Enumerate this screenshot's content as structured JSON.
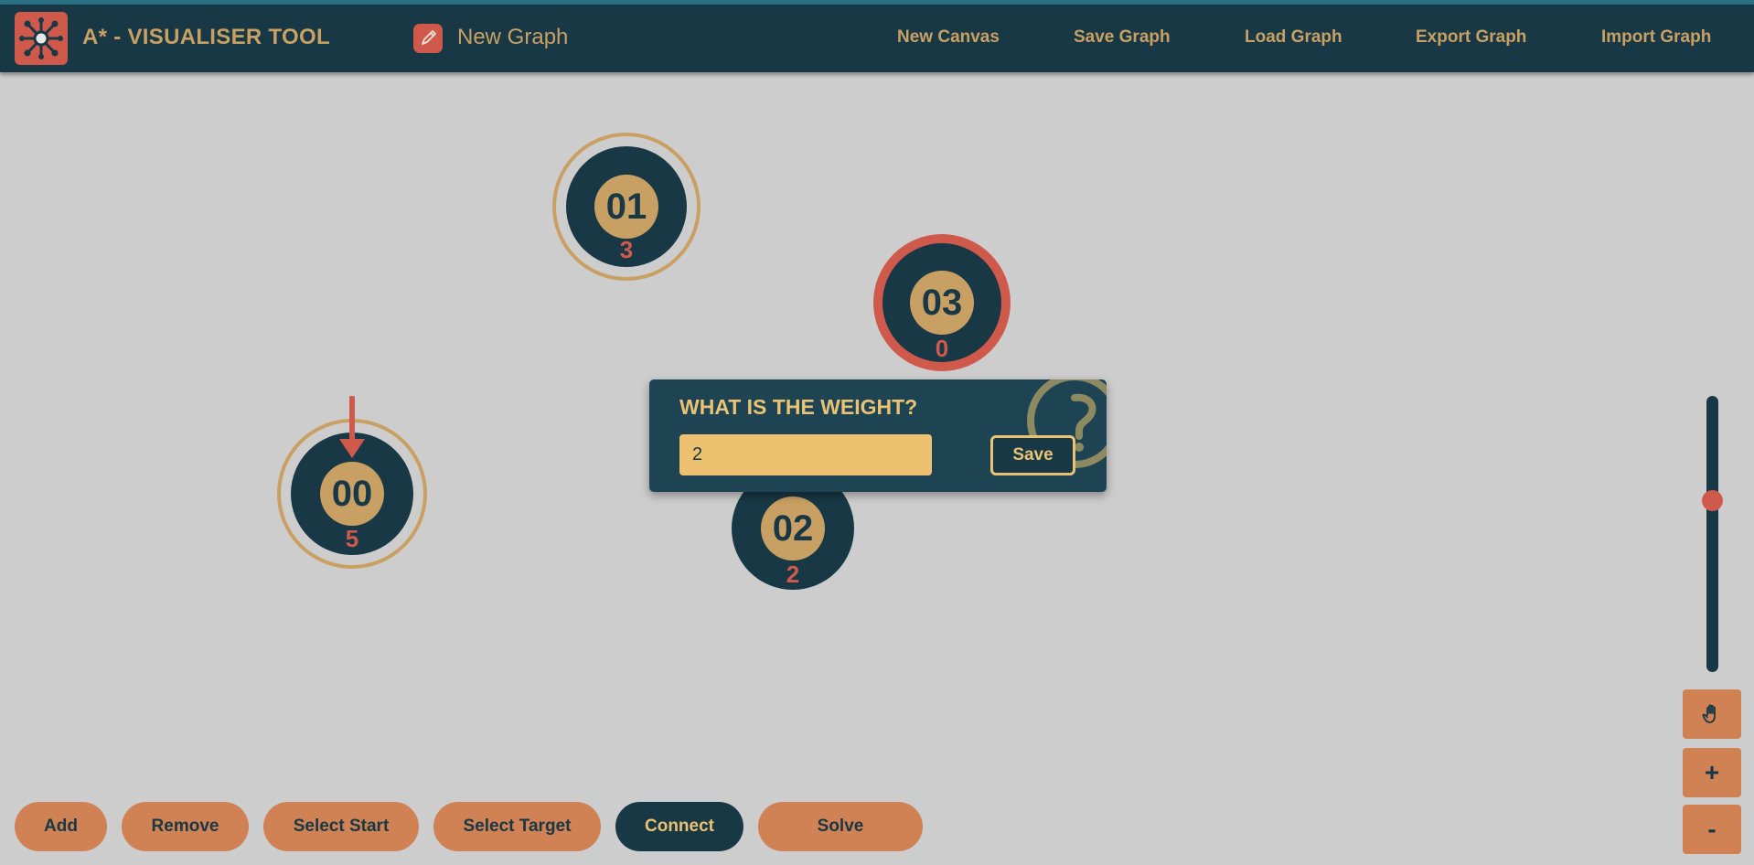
{
  "header": {
    "title": "A* - VISUALISER TOOL",
    "graph_name": "New Graph",
    "nav": [
      "New Canvas",
      "Save Graph",
      "Load Graph",
      "Export Graph",
      "Import Graph"
    ],
    "icons": {
      "logo": "graph-network-icon",
      "rename": "pencil-icon"
    }
  },
  "nodes": [
    {
      "id": "00",
      "weight": "5",
      "role": "start"
    },
    {
      "id": "01",
      "weight": "3",
      "role": "normal"
    },
    {
      "id": "02",
      "weight": "2",
      "role": "plain"
    },
    {
      "id": "03",
      "weight": "0",
      "role": "target"
    }
  ],
  "dialog": {
    "title": "WHAT IS THE WEIGHT?",
    "input_value": "2",
    "save_label": "Save",
    "icon": "question-mark-icon"
  },
  "toolbar": {
    "buttons": [
      "Add",
      "Remove",
      "Select Start",
      "Select Target",
      "Connect",
      "Solve"
    ],
    "active": "Connect"
  },
  "zoom": {
    "level_fraction": 0.62,
    "pan_icon": "hand-icon",
    "zoom_in_label": "+",
    "zoom_out_label": "-"
  },
  "colors": {
    "navy": "#183845",
    "gold": "#c9a063",
    "red": "#cf5a4c",
    "orange": "#d08254",
    "canvas": "#cdcdcd"
  }
}
